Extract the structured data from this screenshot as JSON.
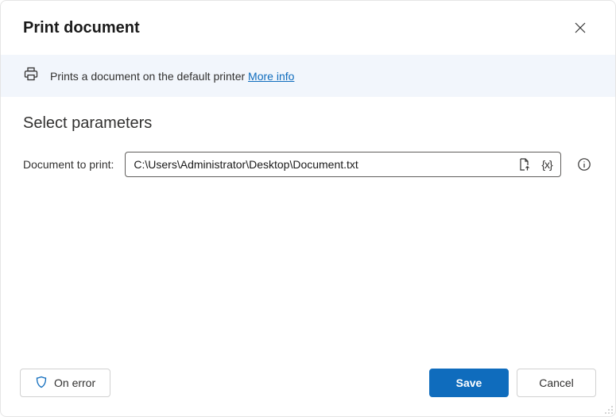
{
  "header": {
    "title": "Print document"
  },
  "banner": {
    "text": "Prints a document on the default printer ",
    "more_info": "More info"
  },
  "params": {
    "section_title": "Select parameters",
    "doc_label": "Document to print:",
    "doc_value": "C:\\Users\\Administrator\\Desktop\\Document.txt",
    "variable_icon_text": "{x}"
  },
  "footer": {
    "on_error": "On error",
    "save": "Save",
    "cancel": "Cancel"
  }
}
